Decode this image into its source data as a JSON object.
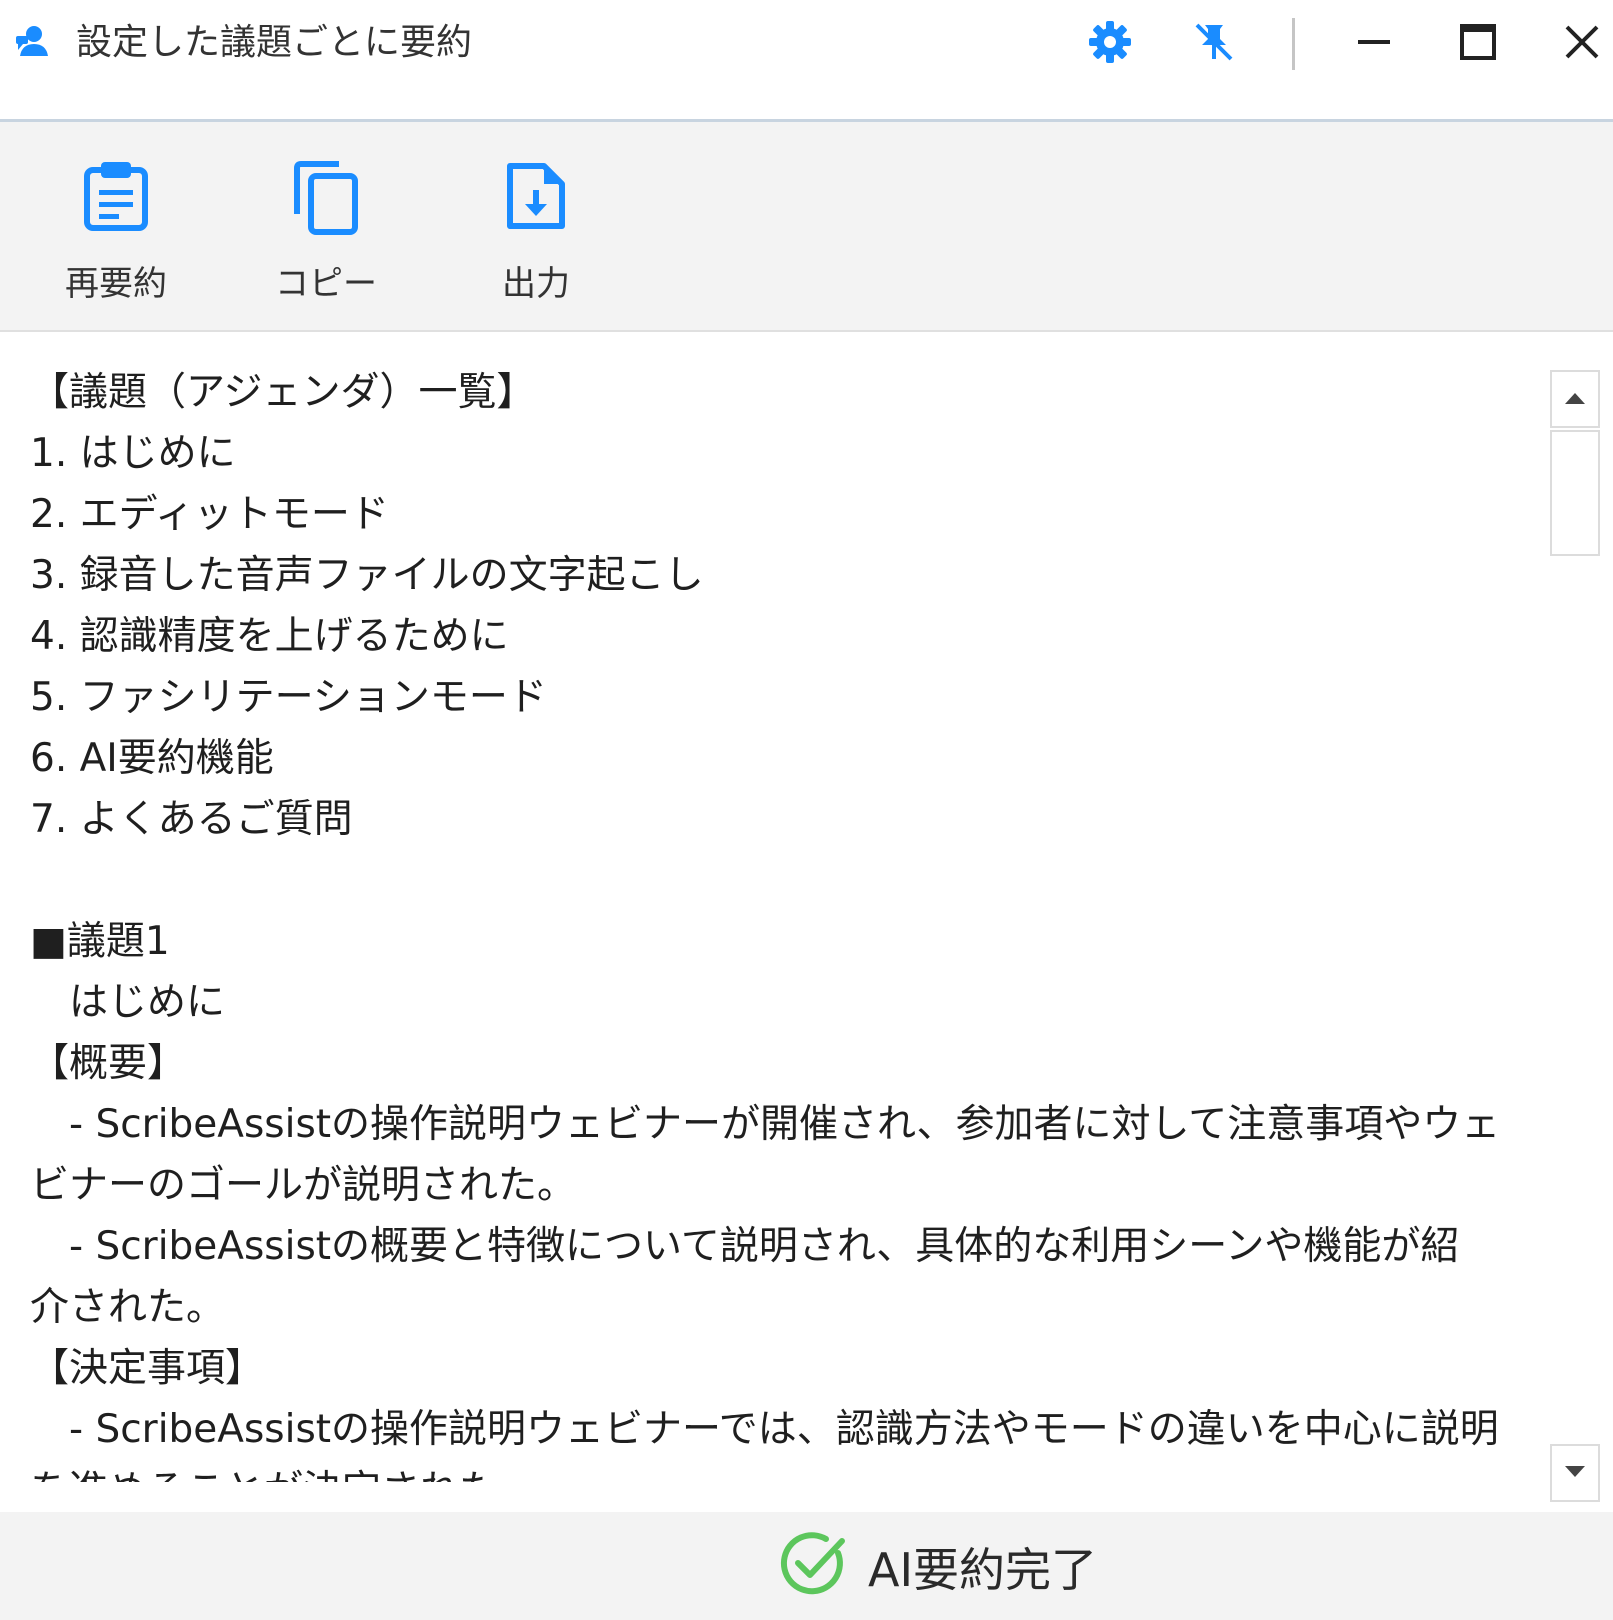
{
  "window": {
    "title": "設定した議題ごとに要約",
    "accent_color": "#1a8cff",
    "controls": {
      "settings_icon": "gear-icon",
      "pin_icon": "unpin-icon",
      "minimize_icon": "minimize-icon",
      "maximize_icon": "maximize-icon",
      "close_icon": "close-icon"
    }
  },
  "toolbar": {
    "items": [
      {
        "label": "再要約",
        "icon": "clipboard-icon"
      },
      {
        "label": "コピー",
        "icon": "copy-icon"
      },
      {
        "label": "出力",
        "icon": "file-download-icon"
      }
    ]
  },
  "summary": {
    "lines": [
      "【議題（アジェンダ）一覧】",
      "1. はじめに",
      "2. エディットモード",
      "3. 録音した音声ファイルの文字起こし",
      "4. 認識精度を上げるために",
      "5. ファシリテーションモード",
      "6. AI要約機能",
      "7. よくあるご質問",
      "",
      "■議題1",
      "　はじめに",
      "【概要】",
      "　- ScribeAssistの操作説明ウェビナーが開催され、参加者に対して注意事項やウェ",
      "ビナーのゴールが説明された。",
      "　- ScribeAssistの概要と特徴について説明され、具体的な利用シーンや機能が紹",
      "介された。",
      "【決定事項】",
      "　- ScribeAssistの操作説明ウェビナーでは、認識方法やモードの違いを中心に説明",
      "を進めることが決定された。"
    ]
  },
  "status": {
    "text": "AI要約完了",
    "icon": "check-circle-icon",
    "color": "#5cc65c"
  }
}
